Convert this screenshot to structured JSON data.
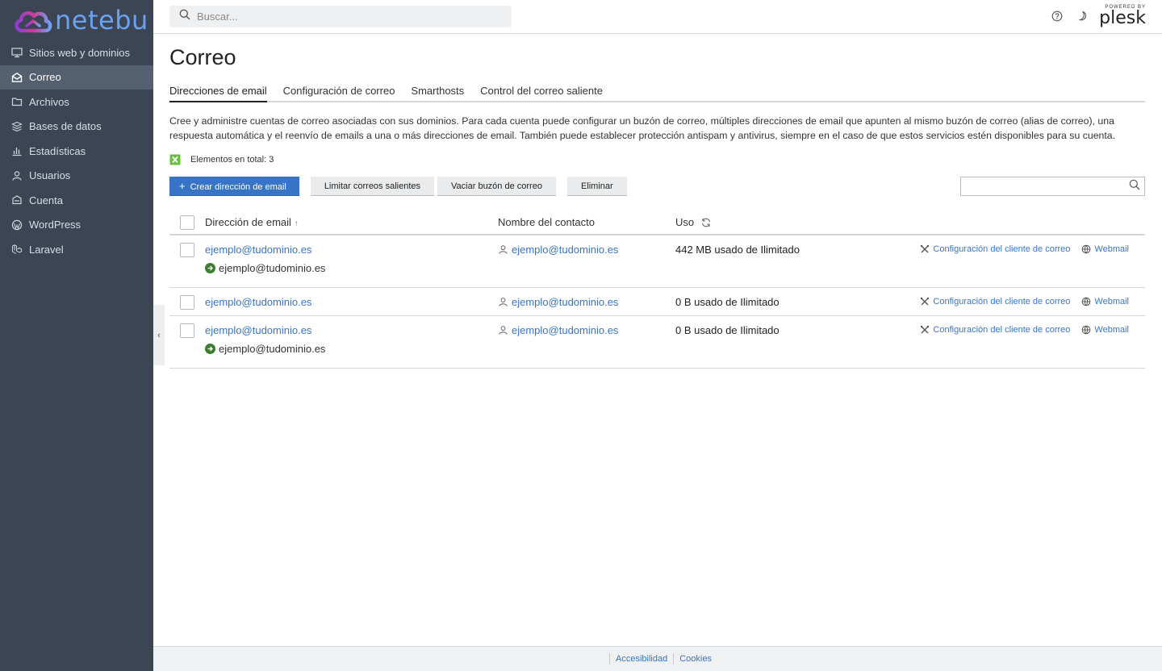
{
  "brand": {
    "name": "netebu"
  },
  "sidebar": {
    "items": [
      {
        "label": "Sitios web y dominios",
        "icon": "monitor-icon"
      },
      {
        "label": "Correo",
        "icon": "envelope-icon",
        "active": true
      },
      {
        "label": "Archivos",
        "icon": "folder-icon"
      },
      {
        "label": "Bases de datos",
        "icon": "database-icon"
      },
      {
        "label": "Estadísticas",
        "icon": "bar-chart-icon"
      },
      {
        "label": "Usuarios",
        "icon": "user-icon"
      },
      {
        "label": "Cuenta",
        "icon": "account-icon"
      },
      {
        "label": "WordPress",
        "icon": "wordpress-icon"
      },
      {
        "label": "Laravel",
        "icon": "laravel-icon"
      }
    ]
  },
  "topbar": {
    "search_placeholder": "Buscar...",
    "powered_by": "POWERED BY",
    "plesk": "plesk"
  },
  "page": {
    "title": "Correo",
    "tabs": [
      {
        "label": "Direcciones de email",
        "active": true
      },
      {
        "label": "Configuración de correo"
      },
      {
        "label": "Smarthosts"
      },
      {
        "label": "Control del correo saliente"
      }
    ],
    "description": "Cree y administre cuentas de correo asociadas con sus dominios. Para cada cuenta puede configurar un buzón de correo, múltiples direcciones de email que apunten al mismo buzón de correo (alias de correo), una respuesta automática y el reenvío de emails a una o más direcciones de email. También puede establecer protección antispam y antivirus, siempre en el caso de que estos servicios estén disponibles para su cuenta.",
    "total": "Elementos en total: 3",
    "toolbar": {
      "create": "Crear dirección de email",
      "limit": "Limitar correos salientes",
      "empty": "Vaciar buzón de correo",
      "delete": "Eliminar"
    },
    "table": {
      "headers": {
        "email": "Dirección de email",
        "sort_indicator": "↑",
        "contact": "Nombre del contacto",
        "usage": "Uso"
      },
      "rows": [
        {
          "email": "ejemplo@tudominio.es",
          "alias": "ejemplo@tudominio.es",
          "contact": "ejemplo@tudominio.es",
          "usage": "442 MB usado de Ilimitado",
          "config": "Configuración del cliente de correo",
          "webmail": "Webmail"
        },
        {
          "email": "ejemplo@tudominio.es",
          "alias": "",
          "contact": "ejemplo@tudominio.es",
          "usage": "0 B usado de Ilimitado",
          "config": "Configuración del cliente de correo",
          "webmail": "Webmail"
        },
        {
          "email": "ejemplo@tudominio.es",
          "alias": "ejemplo@tudominio.es",
          "contact": "ejemplo@tudominio.es",
          "usage": "0 B usado de Ilimitado",
          "config": "Configuración del cliente de correo",
          "webmail": "Webmail"
        }
      ]
    }
  },
  "footer": {
    "accessibility": "Accesibilidad",
    "cookies": "Cookies"
  },
  "colors": {
    "sidebar_bg": "#3b4554",
    "sidebar_active": "#54606f",
    "accent": "#3874c5",
    "logo": "#6aa2ef"
  }
}
